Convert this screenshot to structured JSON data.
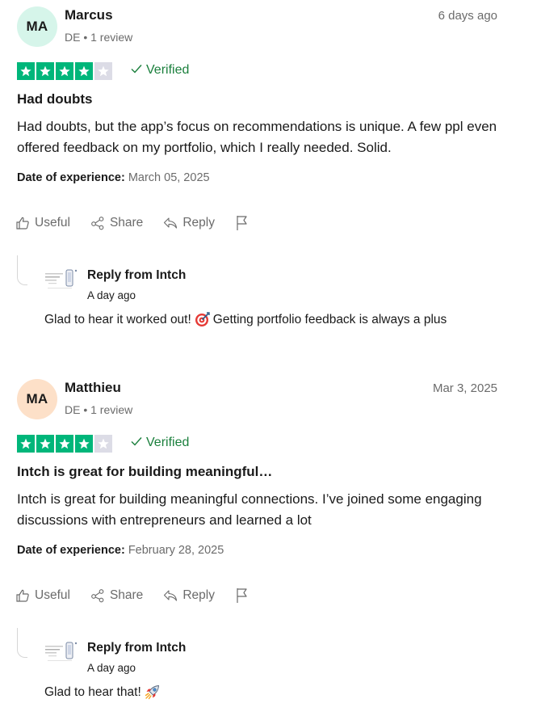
{
  "reviews": [
    {
      "avatar_initials": "MA",
      "avatar_color": "#d6f5ea",
      "author": "Marcus",
      "meta": "DE • 1 review",
      "date": "6 days ago",
      "rating": 4,
      "max_rating": 5,
      "star_color": "#00b67a",
      "verified_label": "Verified",
      "title": "Had doubts",
      "body": "Had doubts, but the app’s focus on recommendations is unique. A few ppl even offered feedback on my portfolio, which I really needed. Solid.",
      "experience_label": "Date of experience:",
      "experience_date": "March 05, 2025",
      "actions": {
        "useful": "Useful",
        "share": "Share",
        "reply": "Reply"
      },
      "reply": {
        "from": "Reply from Intch",
        "date": "A day ago",
        "text_before": "Glad to hear it worked out!",
        "emoji": "direct-hit-icon",
        "text_after": "Getting portfolio feedback is always a plus"
      }
    },
    {
      "avatar_initials": "MA",
      "avatar_color": "#fde0c8",
      "author": "Matthieu",
      "meta": "DE • 1 review",
      "date": "Mar 3, 2025",
      "rating": 4,
      "max_rating": 5,
      "star_color": "#00b67a",
      "verified_label": "Verified",
      "title": "Intch is great for building meaningful…",
      "body": "Intch is great for building meaningful connections. I’ve joined some engaging discussions with entrepreneurs and learned a lot",
      "experience_label": "Date of experience:",
      "experience_date": "February 28, 2025",
      "actions": {
        "useful": "Useful",
        "share": "Share",
        "reply": "Reply"
      },
      "reply": {
        "from": "Reply from Intch",
        "date": "A day ago",
        "text_before": "Glad to hear that!",
        "emoji": "rocket-icon",
        "text_after": ""
      }
    }
  ]
}
